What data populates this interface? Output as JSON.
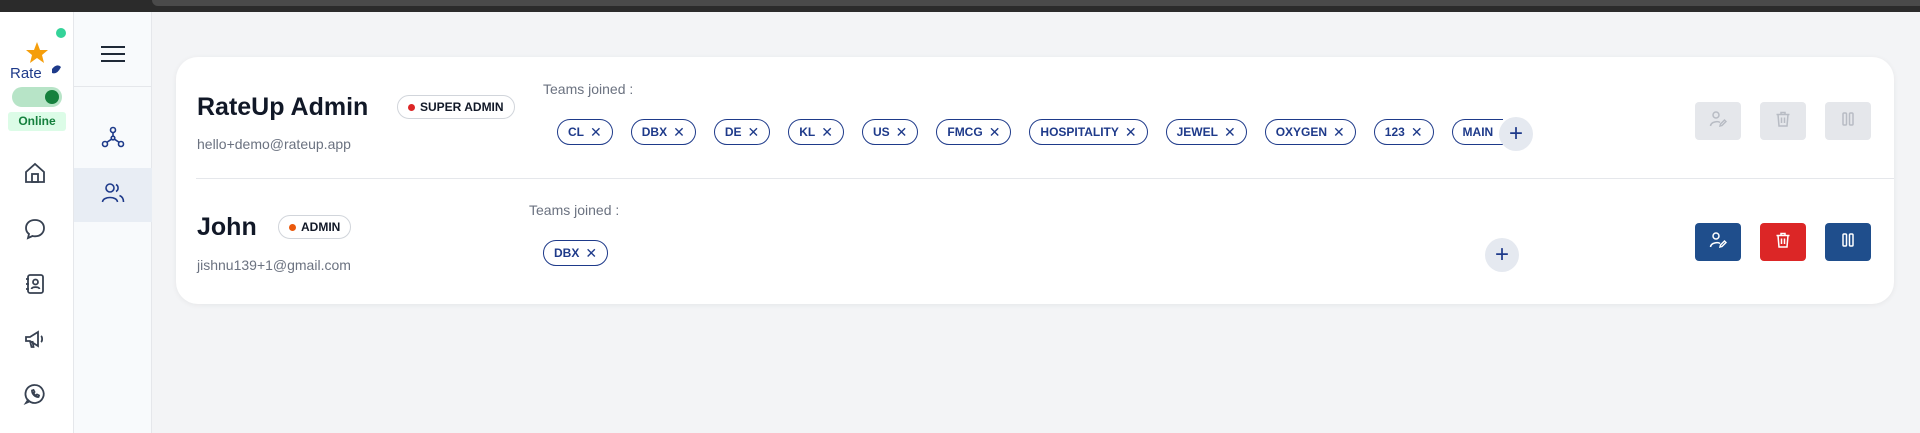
{
  "sidebar": {
    "status": "Online",
    "logo_text": "Rate"
  },
  "teams_label": "Teams joined :",
  "users": [
    {
      "name": "RateUp Admin",
      "role": "SUPER ADMIN",
      "role_dot_color": "#dc2626",
      "email": "hello+demo@rateup.app",
      "teams": [
        "CL",
        "DBX",
        "DE",
        "KL",
        "US",
        "FMCG",
        "HOSPITALITY",
        "JEWEL",
        "OXYGEN",
        "123",
        "MAIN"
      ],
      "actions_enabled": false
    },
    {
      "name": "John",
      "role": "ADMIN",
      "role_dot_color": "#ea580c",
      "email": "jishnu139+1@gmail.com",
      "teams": [
        "DBX"
      ],
      "actions_enabled": true
    }
  ],
  "add_symbol": "+",
  "chip_remove_symbol": "✕",
  "colors": {
    "primary": "#1f4e8c",
    "danger": "#dc2626",
    "online": "#15803d"
  },
  "icons": {
    "rail": [
      "home-icon",
      "chat-icon",
      "contacts-book-icon",
      "megaphone-icon",
      "whatsapp-icon"
    ],
    "secondary": [
      "network-icon",
      "users-icon"
    ],
    "actions": [
      "user-edit-icon",
      "trash-icon",
      "pause-icon"
    ]
  }
}
